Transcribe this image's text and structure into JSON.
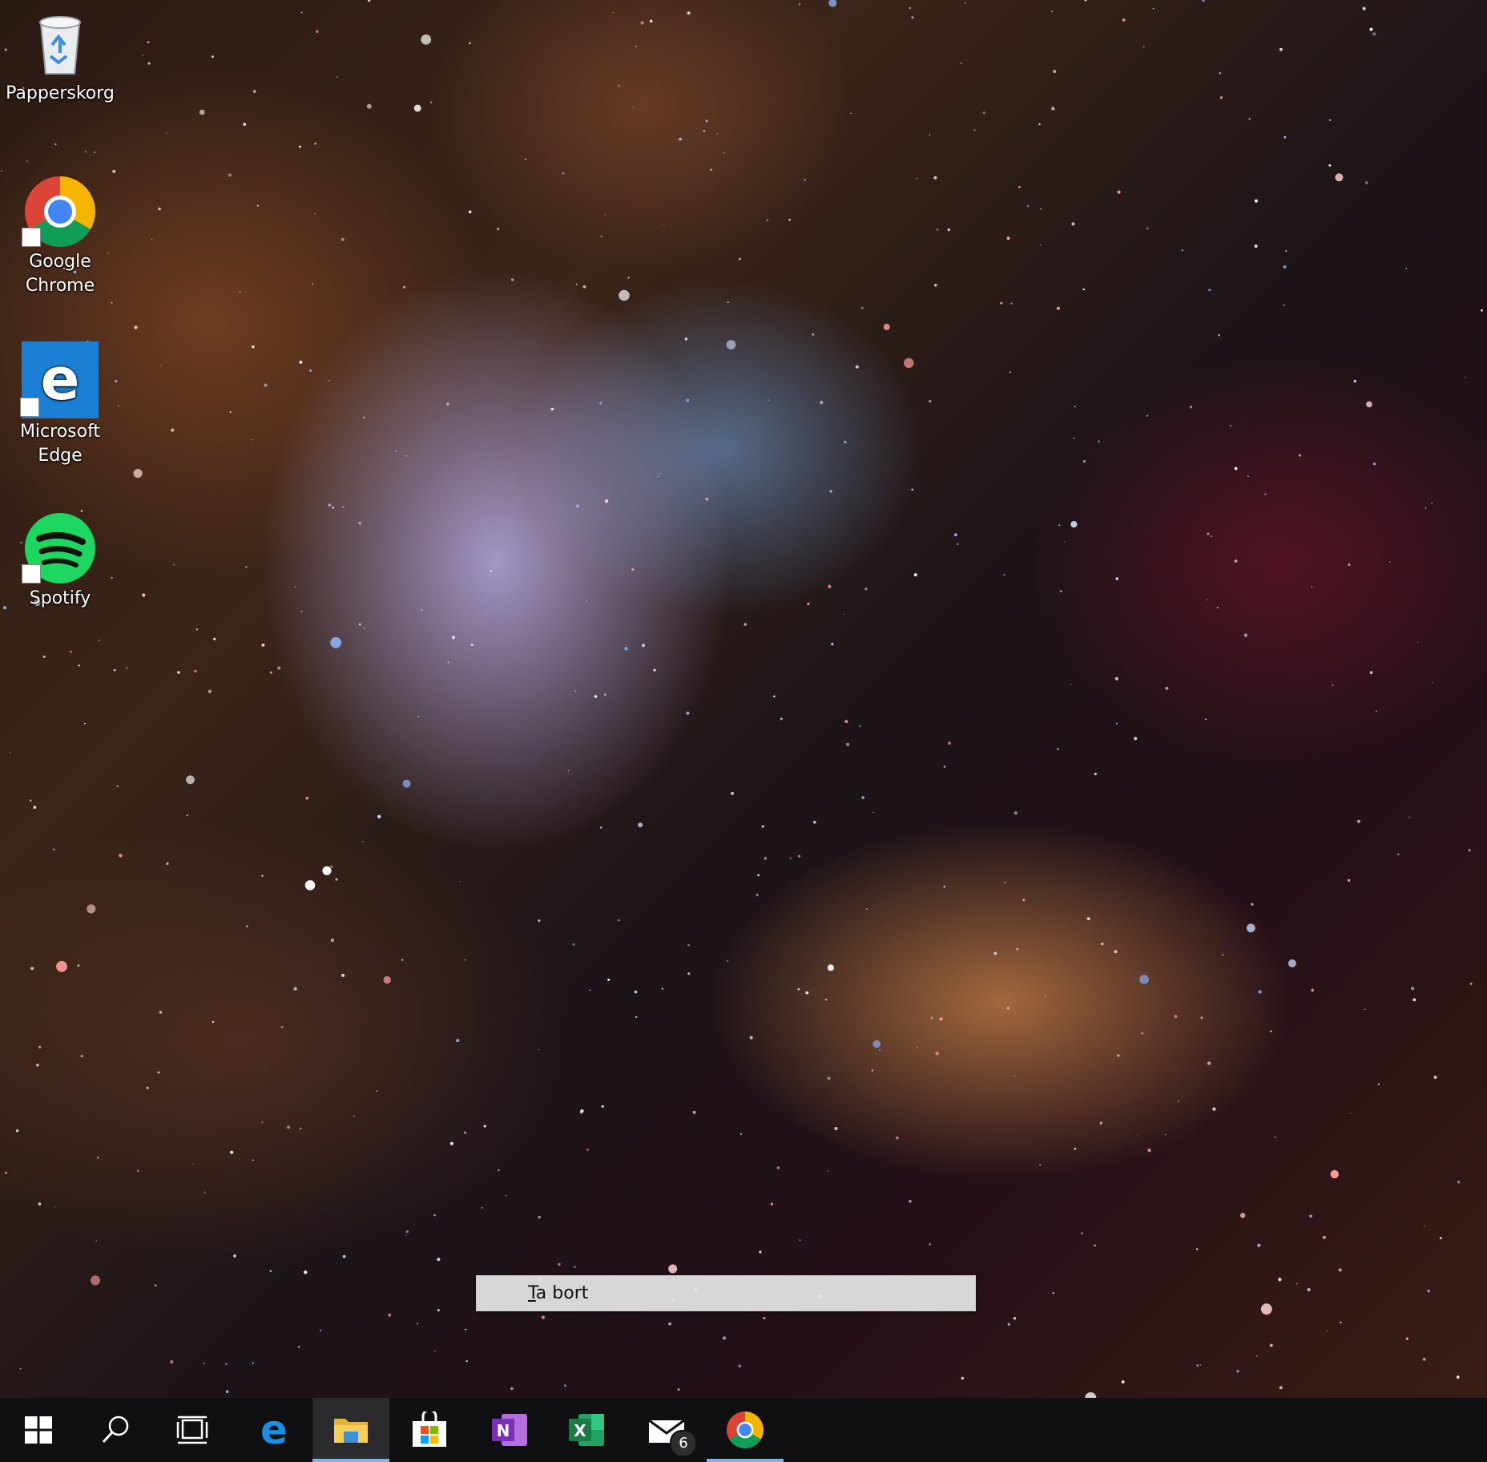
{
  "desktop": {
    "icons": [
      {
        "label": "Papperskorg",
        "icon": "recycle-bin-icon"
      },
      {
        "label": "Google Chrome",
        "icon": "chrome-icon"
      },
      {
        "label": "Microsoft Edge",
        "icon": "edge-icon"
      },
      {
        "label": "Spotify",
        "icon": "spotify-icon"
      }
    ]
  },
  "context_menu": {
    "item_accel": "T",
    "item_rest": "a bort"
  },
  "taskbar": {
    "buttons": [
      {
        "icon": "windows-start-icon"
      },
      {
        "icon": "search-icon"
      },
      {
        "icon": "task-view-icon"
      },
      {
        "icon": "edge-icon"
      },
      {
        "icon": "file-explorer-icon",
        "active": true
      },
      {
        "icon": "microsoft-store-icon"
      },
      {
        "icon": "onenote-icon",
        "letter": "N"
      },
      {
        "icon": "excel-icon",
        "letter": "X"
      },
      {
        "icon": "mail-icon",
        "badge": "6"
      },
      {
        "icon": "chrome-icon",
        "running": true
      }
    ],
    "colors": {
      "background": "#101012",
      "active_underline": "#7fb2e6",
      "onenote": "#7b2fb5",
      "excel": "#1e7a45",
      "edge": "#1b7fd6",
      "spotify": "#1ed760"
    }
  }
}
